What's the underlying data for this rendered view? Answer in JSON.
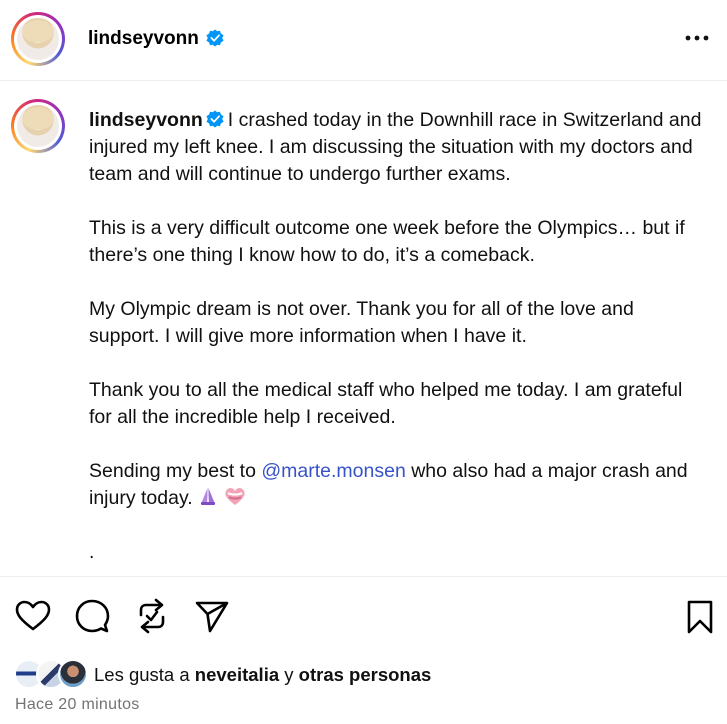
{
  "header": {
    "username": "lindseyvonn",
    "verified": true,
    "more_icon": "more-horizontal-icon"
  },
  "caption": {
    "username": "lindseyvonn",
    "first_line": "I crashed today in the Downhill race in Switzerland and injured my left knee. I am discussing the situation with my doctors and team and will continue to undergo further exams.",
    "paragraph_2": "This is a very difficult outcome one week before the Olympics… but if there’s one thing I know how to do, it’s a comeback.",
    "paragraph_3": "My Olympic dream is not over. Thank you for all of the love and support. I will give more information when I have it.",
    "paragraph_4": "Thank you to all the medical staff who helped me today. I am grateful for all the incredible help I received.",
    "paragraph_5_before": "Sending my best to ",
    "paragraph_5_mention": "@marte.monsen",
    "paragraph_5_after": " who also had a major crash and injury today.",
    "emojis": [
      "folded-hands-emoji",
      "heart-emoji"
    ],
    "trailing": "."
  },
  "actions": {
    "icons": [
      "heart-icon",
      "comment-icon",
      "repost-icon",
      "share-icon",
      "bookmark-icon"
    ]
  },
  "likes": {
    "prefix": "Les gusta a ",
    "user": "neveitalia",
    "connector": " y ",
    "others": "otras personas"
  },
  "timestamp": "Hace 20 minutos",
  "colors": {
    "verified": "#0095f6",
    "mention": "#3753c9",
    "muted": "#737373",
    "divider": "#efefef"
  }
}
